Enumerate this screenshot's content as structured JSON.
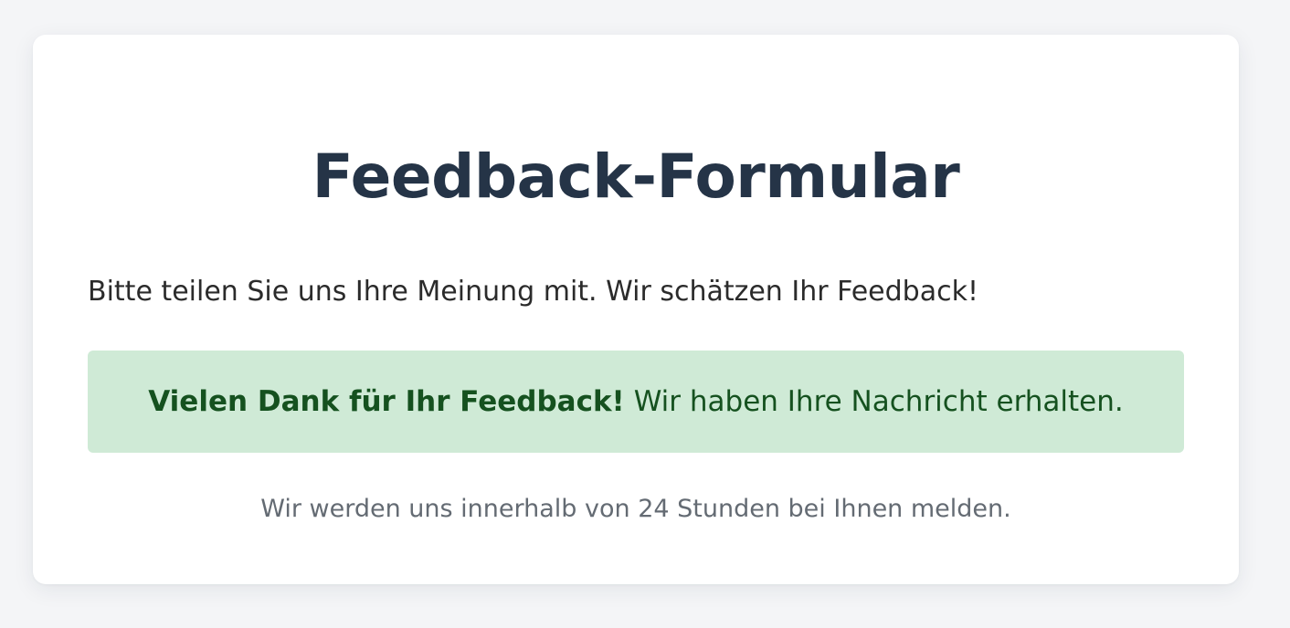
{
  "form": {
    "title": "Feedback-Formular",
    "intro": "Bitte teilen Sie uns Ihre Meinung mit. Wir schätzen Ihr Feedback!",
    "success": {
      "strong": "Vielen Dank für Ihr Feedback!",
      "message": "Wir haben Ihre Nachricht erhalten."
    },
    "footnote": "Wir werden uns innerhalb von 24 Stunden bei Ihnen melden."
  },
  "colors": {
    "page_background": "#f4f5f7",
    "card_background": "#ffffff",
    "title": "#253447",
    "success_background": "#cfead6",
    "success_text": "#15511f",
    "footnote": "#646b73"
  }
}
